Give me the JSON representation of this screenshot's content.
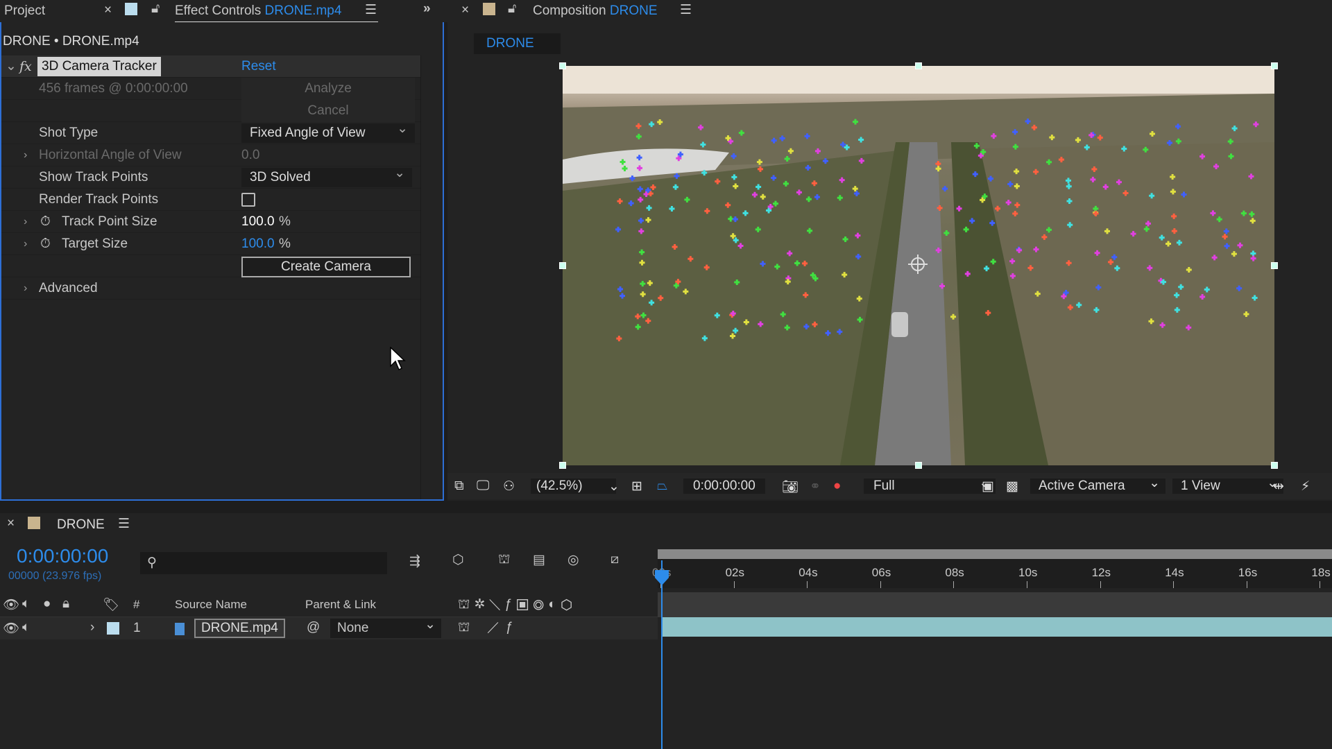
{
  "tabs": {
    "project": "Project",
    "effect_controls": "Effect Controls",
    "effect_controls_target": "DRONE.mp4",
    "composition": "Composition",
    "composition_target": "DRONE"
  },
  "effect_panel": {
    "breadcrumb": "DRONE • DRONE.mp4",
    "effect_name": "3D Camera Tracker",
    "reset": "Reset",
    "frames_info": "456 frames @ 0:00:00:00",
    "analyze": "Analyze",
    "cancel": "Cancel",
    "shot_type_label": "Shot Type",
    "shot_type_value": "Fixed Angle of View",
    "hav_label": "Horizontal Angle of View",
    "hav_value": "0.0",
    "show_tp_label": "Show Track Points",
    "show_tp_value": "3D Solved",
    "render_tp_label": "Render Track Points",
    "render_tp_checked": false,
    "tp_size_label": "Track Point Size",
    "tp_size_value": "100.0",
    "pct": "%",
    "target_size_label": "Target Size",
    "target_size_value": "100.0",
    "create_camera": "Create Camera",
    "advanced": "Advanced"
  },
  "comp": {
    "tab": "DRONE",
    "zoom": "(42.5%)",
    "timecode": "0:00:00:00",
    "resolution": "Full",
    "camera": "Active Camera",
    "views": "1 View"
  },
  "timeline": {
    "title": "DRONE",
    "timecode": "0:00:00:00",
    "frame_info": "00000 (23.976 fps)",
    "col_num": "#",
    "col_source": "Source Name",
    "col_parent": "Parent & Link",
    "layer": {
      "index": "1",
      "name": "DRONE.mp4",
      "parent": "None"
    },
    "ticks": [
      "00s",
      "02s",
      "04s",
      "06s",
      "08s",
      "10s",
      "12s",
      "14s",
      "16s",
      "18s"
    ]
  },
  "colors": {
    "accent": "#2d8ceb",
    "track_bar": "#8ec3c8"
  }
}
